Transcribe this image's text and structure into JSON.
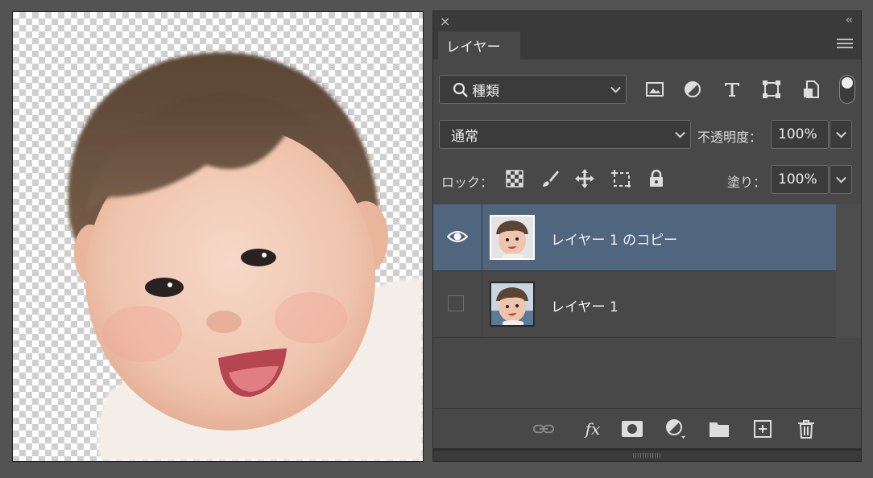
{
  "panel": {
    "close_glyph": "×",
    "collapse_glyph": "‹‹",
    "tab_label": "レイヤー",
    "menu_icon": "hamburger-menu-icon",
    "filter": {
      "icon": "search-icon",
      "value": "種類"
    },
    "filter_icons": [
      "image-filter-icon",
      "adjustment-filter-icon",
      "type-filter-icon",
      "shape-filter-icon",
      "smart-object-filter-icon"
    ],
    "blend_mode": "通常",
    "opacity_label": "不透明度：",
    "opacity_value": "100%",
    "lock_label": "ロック：",
    "lock_icons": [
      "lock-transparency-icon",
      "lock-paint-icon",
      "lock-position-icon",
      "lock-artboard-icon",
      "lock-all-icon"
    ],
    "fill_label": "塗り：",
    "fill_value": "100%",
    "layers": [
      {
        "name": "レイヤー 1 のコピー",
        "visible": true,
        "selected": true
      },
      {
        "name": "レイヤー 1",
        "visible": false,
        "selected": false
      }
    ],
    "footer_icons": [
      "link-icon",
      "fx-icon",
      "mask-icon",
      "adjustment-layer-icon",
      "group-folder-icon",
      "new-layer-icon",
      "trash-icon"
    ],
    "fx_label": "fx"
  },
  "colors": {
    "selected_row": "#50667f",
    "panel_bg": "#484848",
    "app_bg": "#535353"
  }
}
